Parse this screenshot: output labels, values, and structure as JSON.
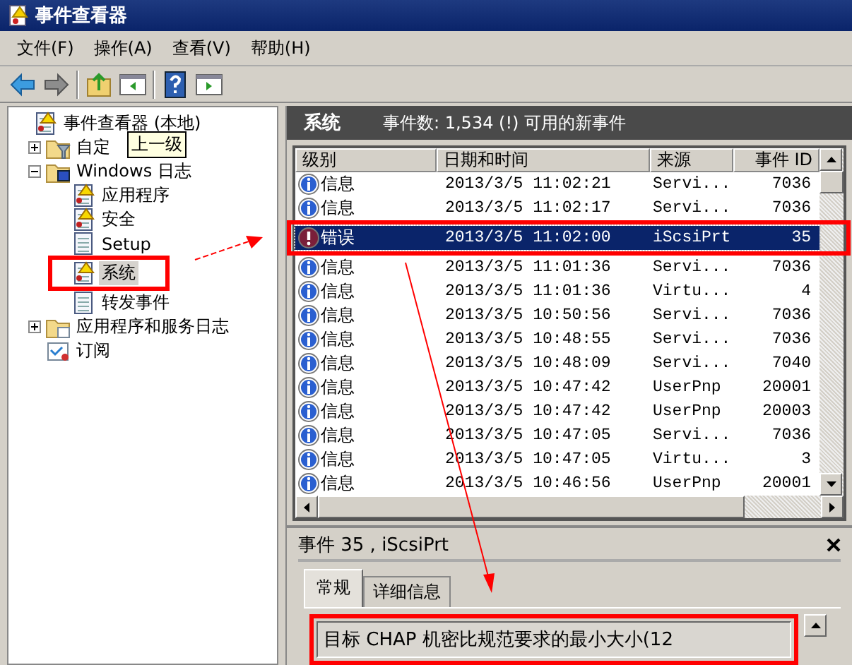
{
  "window": {
    "title": "事件查看器"
  },
  "menu": [
    {
      "label": "文件(F)"
    },
    {
      "label": "操作(A)"
    },
    {
      "label": "查看(V)"
    },
    {
      "label": "帮助(H)"
    }
  ],
  "toolbar": [
    {
      "kind": "back",
      "disabled": false
    },
    {
      "kind": "forward",
      "disabled": true
    },
    {
      "kind": "up",
      "disabled": false
    },
    {
      "kind": "pane-left",
      "disabled": false
    },
    {
      "kind": "help",
      "disabled": false
    },
    {
      "kind": "pane-right",
      "disabled": false
    }
  ],
  "tree": [
    {
      "label": "事件查看器 (本地)",
      "kind": "viewer",
      "selected": false,
      "children": [
        {
          "label": "自定",
          "kind": "filter-folder",
          "expanded": false,
          "selected": false
        },
        {
          "label": "Windows 日志",
          "kind": "windows-folder",
          "expanded": true,
          "selected": false,
          "children": [
            {
              "label": "应用程序",
              "kind": "log-alert",
              "selected": false
            },
            {
              "label": "安全",
              "kind": "log-alert",
              "selected": false
            },
            {
              "label": "Setup",
              "kind": "log",
              "selected": false
            },
            {
              "label": "系统",
              "kind": "log-alert",
              "selected": true
            },
            {
              "label": "转发事件",
              "kind": "log",
              "selected": false
            }
          ]
        },
        {
          "label": "应用程序和服务日志",
          "kind": "folder",
          "expanded": false,
          "selected": false
        },
        {
          "label": "订阅",
          "kind": "subscription",
          "selected": false
        }
      ]
    }
  ],
  "tooltip": {
    "text": "上一级"
  },
  "log_header": {
    "title": "系统",
    "info": "事件数: 1,534 (!) 可用的新事件"
  },
  "table": {
    "columns": [
      "级别",
      "日期和时间",
      "来源",
      "事件 ID"
    ],
    "rows": [
      {
        "kind": "info",
        "level": "信息",
        "date": "2013/3/5 11:02:21",
        "source": "Servi...",
        "id": "7036",
        "selected": false
      },
      {
        "kind": "info",
        "level": "信息",
        "date": "2013/3/5 11:02:17",
        "source": "Servi...",
        "id": "7036",
        "selected": false
      },
      {
        "kind": "error",
        "level": "错误",
        "date": "2013/3/5 11:02:00",
        "source": "iScsiPrt",
        "id": "35",
        "selected": true
      },
      {
        "kind": "info",
        "level": "信息",
        "date": "2013/3/5 11:01:36",
        "source": "Servi...",
        "id": "7036",
        "selected": false
      },
      {
        "kind": "info",
        "level": "信息",
        "date": "2013/3/5 11:01:36",
        "source": "Virtu...",
        "id": "4",
        "selected": false
      },
      {
        "kind": "info",
        "level": "信息",
        "date": "2013/3/5 10:50:56",
        "source": "Servi...",
        "id": "7036",
        "selected": false
      },
      {
        "kind": "info",
        "level": "信息",
        "date": "2013/3/5 10:48:55",
        "source": "Servi...",
        "id": "7036",
        "selected": false
      },
      {
        "kind": "info",
        "level": "信息",
        "date": "2013/3/5 10:48:09",
        "source": "Servi...",
        "id": "7040",
        "selected": false
      },
      {
        "kind": "info",
        "level": "信息",
        "date": "2013/3/5 10:47:42",
        "source": "UserPnp",
        "id": "20001",
        "selected": false
      },
      {
        "kind": "info",
        "level": "信息",
        "date": "2013/3/5 10:47:42",
        "source": "UserPnp",
        "id": "20003",
        "selected": false
      },
      {
        "kind": "info",
        "level": "信息",
        "date": "2013/3/5 10:47:05",
        "source": "Servi...",
        "id": "7036",
        "selected": false
      },
      {
        "kind": "info",
        "level": "信息",
        "date": "2013/3/5 10:47:05",
        "source": "Virtu...",
        "id": "3",
        "selected": false
      },
      {
        "kind": "info",
        "level": "信息",
        "date": "2013/3/5 10:46:56",
        "source": "UserPnp",
        "id": "20001",
        "selected": false
      }
    ]
  },
  "detail": {
    "title": "事件 35 , iScsiPrt",
    "tabs": [
      {
        "label": "常规",
        "selected": true
      },
      {
        "label": "详细信息",
        "selected": false
      }
    ],
    "message": "目标 CHAP 机密比规范要求的最小大小(12"
  }
}
